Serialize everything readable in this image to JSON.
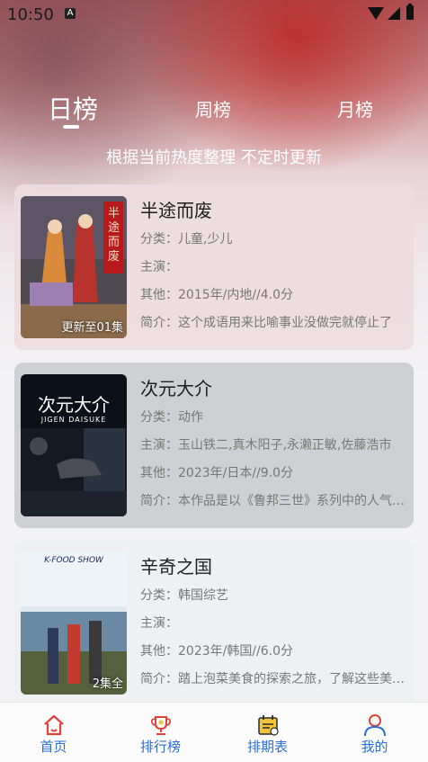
{
  "status_bar": {
    "time": "10:50",
    "notification_icon": "A",
    "icons": [
      "wifi-icon",
      "signal-icon",
      "battery-icon"
    ]
  },
  "tabs": [
    {
      "label": "日榜",
      "active": true
    },
    {
      "label": "周榜",
      "active": false
    },
    {
      "label": "月榜",
      "active": false
    }
  ],
  "subtitle": "根据当前热度整理 不定时更新",
  "items": [
    {
      "title": "半途而废",
      "category": "分类：儿童,少儿",
      "cast": "主演：",
      "other": "其他：2015年/内地//4.0分",
      "intro": "简介：这个成语用来比喻事业没做完就停止了",
      "badge": "更新至01集",
      "poster_text": "半途而废"
    },
    {
      "title": "次元大介",
      "category": "分类：动作",
      "cast": "主演：玉山铁二,真木阳子,永濑正敏,佐藤浩市",
      "other": "其他：2023年/日本//9.0分",
      "intro": "简介：本作品是以《鲁邦三世》系列中的人气角色",
      "badge": "",
      "poster_text": "次元大介",
      "poster_subtext": "JIGEN DAISUKE"
    },
    {
      "title": "辛奇之国",
      "category": "分类：韩国综艺",
      "cast": "主演：",
      "other": "其他：2023年/韩国//6.0分",
      "intro": "简介：踏上泡菜美食的探索之旅，了解这些美食背后的故事",
      "badge": "2集全",
      "poster_text": "K-FOOD SHOW"
    }
  ],
  "bottom_nav": [
    {
      "label": "首页",
      "icon": "home-icon"
    },
    {
      "label": "排行榜",
      "icon": "trophy-icon"
    },
    {
      "label": "排期表",
      "icon": "calendar-icon"
    },
    {
      "label": "我的",
      "icon": "user-icon"
    }
  ],
  "colors": {
    "accent": "#2d6ed8",
    "nav_icon": "#e0433a",
    "calendar_icon": "#f2c43d"
  }
}
